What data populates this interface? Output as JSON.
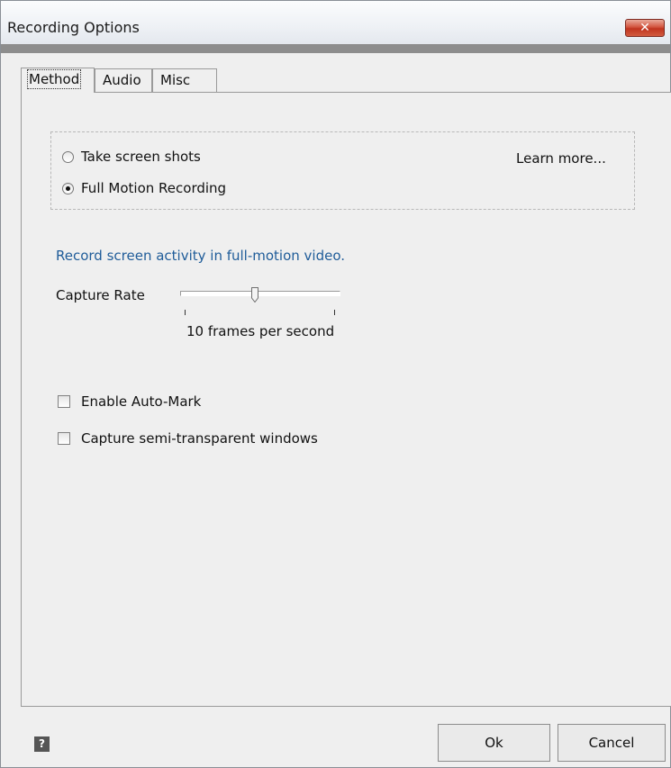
{
  "window": {
    "title": "Recording Options",
    "close_glyph": "✕"
  },
  "tabs": [
    {
      "label": "Method",
      "active": true
    },
    {
      "label": "Audio",
      "active": false
    },
    {
      "label": "Misc",
      "active": false
    }
  ],
  "method": {
    "options": [
      {
        "label": "Take screen shots",
        "selected": false
      },
      {
        "label": "Full Motion Recording",
        "selected": true
      }
    ],
    "learn_more": "Learn more..."
  },
  "description": "Record screen activity in full-motion video.",
  "capture_rate": {
    "label": "Capture Rate",
    "value_text": "10 frames per second"
  },
  "checkboxes": [
    {
      "label": "Enable Auto-Mark",
      "checked": false
    },
    {
      "label": "Capture semi-transparent windows",
      "checked": false
    }
  ],
  "footer": {
    "help_glyph": "?",
    "ok_label": "Ok",
    "cancel_label": "Cancel"
  },
  "colors": {
    "description": "#1f5c99",
    "close_button": "#c9442e"
  },
  "icons": {
    "close": "close-icon",
    "help": "help-icon"
  }
}
